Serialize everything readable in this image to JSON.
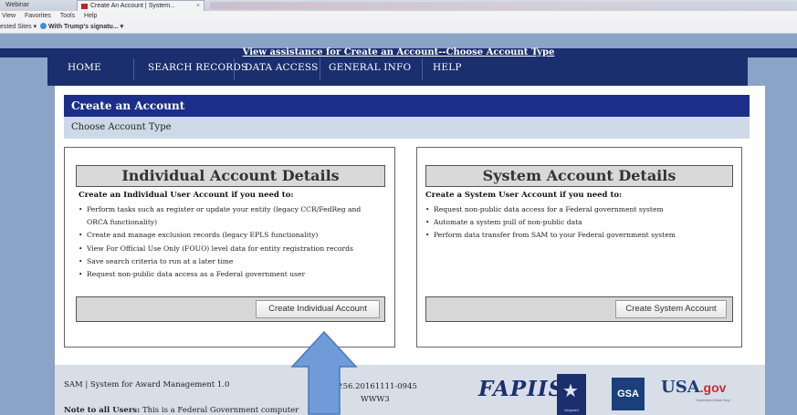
{
  "browser": {
    "tab_left": "Webinar",
    "active_tab": "Create An Account | System...",
    "tab_close": "×",
    "menu": [
      "View",
      "Favorites",
      "Tools",
      "Help"
    ],
    "favorites": [
      "ested Sites ▾",
      "With Trump's signatu... ▾"
    ]
  },
  "assist_link": "View assistance for Create an Account--Choose Account Type",
  "nav": [
    "HOME",
    "SEARCH RECORDS",
    "DATA ACCESS",
    "GENERAL INFO",
    "HELP"
  ],
  "page": {
    "header": "Create an Account",
    "subheader": "Choose Account Type"
  },
  "individual": {
    "title": "Individual Account Details",
    "lead": "Create an Individual User Account if you need to:",
    "items": [
      "Perform tasks such as register or update your entity (legacy CCR/FedReg and",
      "ORCA functionality)",
      "Create and manage exclusion records (legacy EPLS functionality)",
      "View For Official Use Only (FOUO) level data for entity registration records",
      "Save search criteria to run at a later time",
      "Request non-public data access as a Federal government user"
    ],
    "button": "Create Individual Account"
  },
  "system": {
    "title": "System Account Details",
    "lead": "Create a System User Account if you need to:",
    "items": [
      "Request non-public data access for a Federal government system",
      "Automate a system pull of non-public data",
      "Perform data transfer from SAM to your Federal government system"
    ],
    "button": "Create System Account"
  },
  "footer": {
    "sam": "SAM | System for Award Management 1.0",
    "version": "v1.P.56.20161111-0945",
    "server": "WWW3",
    "note_label": "Note to all Users:",
    "note_text": "This is a Federal Government computer",
    "logos": {
      "fapiis": "FAPIIS",
      "badge": "Integrated",
      "gsa": "GSA",
      "usa": "USA",
      "gov": ".gov",
      "usa_sub": "Government Made Easy"
    }
  },
  "colors": {
    "navy": "#1b2f6e",
    "header_blue": "#1b2f8a",
    "page_bg": "#8aa3c7",
    "arrow_fill": "#6f9bd9"
  },
  "icons": [
    "up-arrow-icon",
    "star-icon",
    "ie-icon"
  ]
}
